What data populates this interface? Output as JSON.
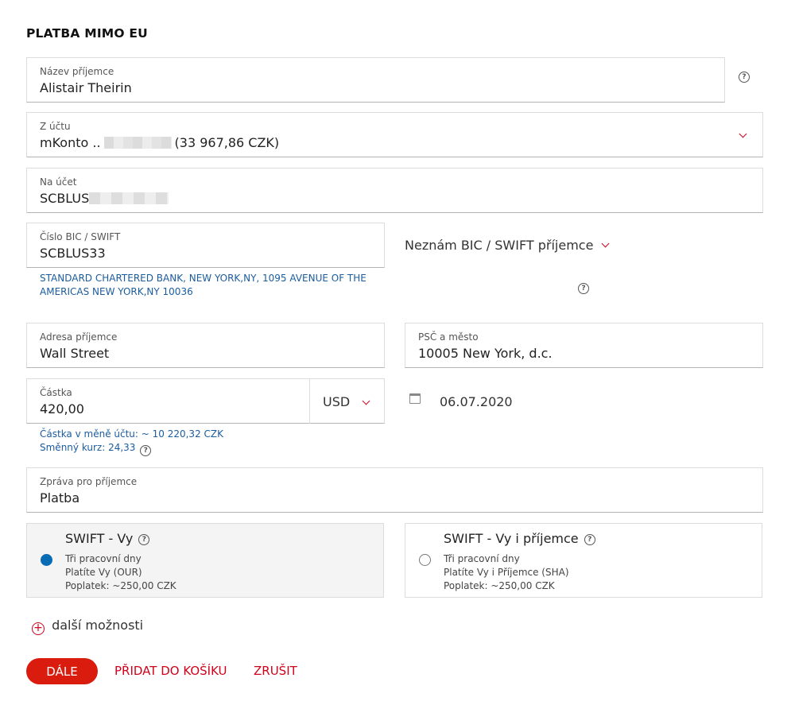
{
  "title": "PLATBA MIMO EU",
  "recipient_name": {
    "label": "Název příjemce",
    "value": "Alistair Theirin"
  },
  "from_account": {
    "label": "Z účtu",
    "prefix": "mKonto ..",
    "balance": "(33 967,86 CZK)"
  },
  "to_account": {
    "label": "Na účet",
    "value": "SCBLUS"
  },
  "bic": {
    "label": "Číslo BIC / SWIFT",
    "value": "SCBLUS33",
    "bank_line1": "STANDARD CHARTERED BANK, NEW YORK,NY, 1095 AVENUE OF THE",
    "bank_line2": "AMERICAS NEW YORK,NY 10036",
    "unknown_toggle": "Neznám BIC / SWIFT příjemce"
  },
  "address": {
    "label": "Adresa příjemce",
    "value": "Wall Street"
  },
  "city": {
    "label": "PSČ a město",
    "value": "10005 New York, d.c."
  },
  "amount": {
    "label": "Částka",
    "value": "420,00",
    "currency": "USD",
    "converted": "Částka v měně účtu: ~ 10 220,32 CZK",
    "rate": "Směnný kurz: 24,33"
  },
  "date": "06.07.2020",
  "message": {
    "label": "Zpráva pro příjemce",
    "value": "Platba"
  },
  "fee_options": [
    {
      "title": "SWIFT - Vy",
      "line1": "Tři pracovní dny",
      "line2": "Platíte Vy (OUR)",
      "line3": "Poplatek: ~250,00 CZK",
      "selected": true
    },
    {
      "title": "SWIFT - Vy i příjemce",
      "line1": "Tři pracovní dny",
      "line2": "Platíte Vy i Příjemce (SHA)",
      "line3": "Poplatek: ~250,00 CZK",
      "selected": false
    }
  ],
  "more_options": "další možnosti",
  "buttons": {
    "next": "DÁLE",
    "add_to_cart": "PŘIDAT DO KOŠÍKU",
    "cancel": "ZRUŠIT"
  },
  "colors": {
    "accent": "#d0021b",
    "link_blue": "#1a5c9e",
    "radio_selected": "#0a6bb5"
  }
}
